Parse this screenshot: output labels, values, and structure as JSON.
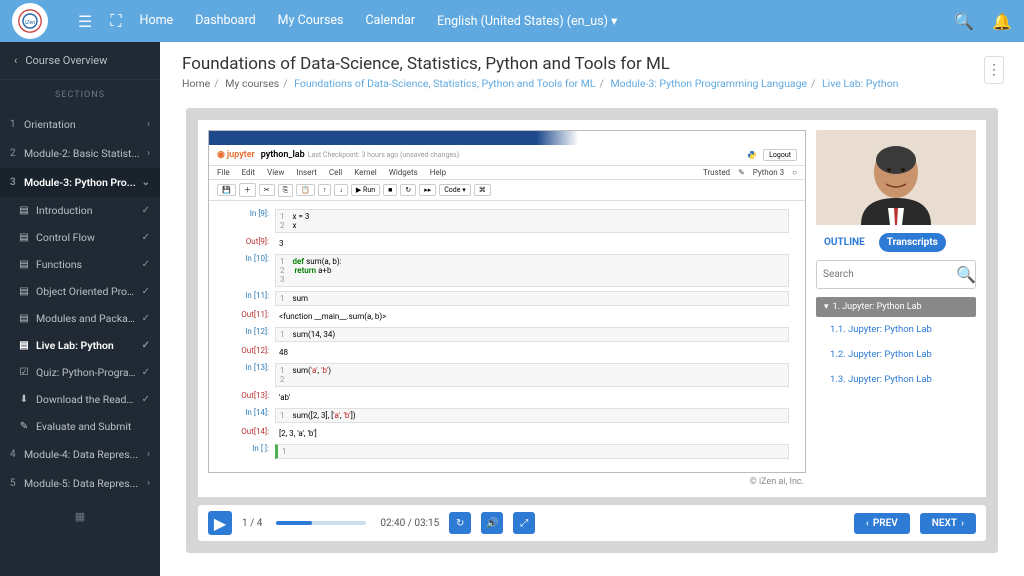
{
  "topbar": {
    "links": [
      "Home",
      "Dashboard",
      "My Courses",
      "Calendar",
      "English (United States) (en_us)"
    ]
  },
  "sidebar": {
    "back": "Course Overview",
    "heading": "SECTIONS",
    "sections": [
      {
        "num": "1",
        "label": "Orientation",
        "expanded": false
      },
      {
        "num": "2",
        "label": "Module-2: Basic Statist...",
        "expanded": false
      },
      {
        "num": "3",
        "label": "Module-3: Python Pro...",
        "expanded": true,
        "active": true
      },
      {
        "num": "4",
        "label": "Module-4: Data Repres...",
        "expanded": false
      },
      {
        "num": "5",
        "label": "Module-5: Data Repres...",
        "expanded": false
      }
    ],
    "subitems": [
      {
        "icon": "doc",
        "label": "Introduction",
        "done": true
      },
      {
        "icon": "doc",
        "label": "Control Flow",
        "done": true
      },
      {
        "icon": "doc",
        "label": "Functions",
        "done": true
      },
      {
        "icon": "doc",
        "label": "Object Oriented Progr...",
        "done": true
      },
      {
        "icon": "doc",
        "label": "Modules and Packages",
        "done": true
      },
      {
        "icon": "doc",
        "label": "Live Lab: Python",
        "done": true,
        "active": true
      },
      {
        "icon": "quiz",
        "label": "Quiz: Python-Program...",
        "done": true
      },
      {
        "icon": "dl",
        "label": "Download the Readme...",
        "done": true
      },
      {
        "icon": "submit",
        "label": "Evaluate and Submit"
      }
    ]
  },
  "page": {
    "title": "Foundations of Data-Science, Statistics, Python and Tools for ML",
    "breadcrumb": [
      "Home",
      "My courses",
      "Foundations of Data-Science, Statistics, Python and Tools for ML",
      "Module-3: Python Programming Language",
      "Live Lab: Python"
    ]
  },
  "jupyter": {
    "logo": "jupyter",
    "title": "python_lab",
    "meta": "Last Checkpoint: 3 hours ago  (unsaved changes)",
    "logout": "Logout",
    "trusted": "Trusted",
    "kernel": "Python 3",
    "menu": [
      "File",
      "Edit",
      "View",
      "Insert",
      "Cell",
      "Kernel",
      "Widgets",
      "Help"
    ],
    "toolbar": {
      "run": "▶ Run",
      "celltype": "Code"
    },
    "cells": [
      {
        "type": "in",
        "n": "9",
        "lines": [
          "x = 3",
          "x"
        ]
      },
      {
        "type": "out",
        "n": "9",
        "text": "3"
      },
      {
        "type": "in",
        "n": "10",
        "lines": [
          "def sum(a, b):",
          "    return a+b",
          ""
        ]
      },
      {
        "type": "in",
        "n": "11",
        "lines": [
          "sum"
        ]
      },
      {
        "type": "out",
        "n": "11",
        "text": "<function __main__.sum(a, b)>"
      },
      {
        "type": "in",
        "n": "12",
        "lines": [
          "sum(14, 34)"
        ]
      },
      {
        "type": "out",
        "n": "12",
        "text": "48"
      },
      {
        "type": "in",
        "n": "13",
        "lines": [
          "sum('a', 'b')",
          ""
        ]
      },
      {
        "type": "out",
        "n": "13",
        "text": "'ab'"
      },
      {
        "type": "in",
        "n": "14",
        "lines": [
          "sum([2, 3], ['a', 'b'])"
        ]
      },
      {
        "type": "out",
        "n": "14",
        "text": "[2, 3, 'a', 'b']"
      },
      {
        "type": "in",
        "n": "",
        "lines": [
          ""
        ],
        "active": true
      }
    ]
  },
  "copyright": "© iZen ai, Inc.",
  "player": {
    "slide": "1 / 4",
    "time": "02:40 / 03:15",
    "prev": "PREV",
    "next": "NEXT"
  },
  "panel": {
    "tabs": {
      "outline": "OUTLINE",
      "trans": "Transcripts"
    },
    "search_placeholder": "Search",
    "ts_head": "1. Jupyter: Python Lab",
    "ts_items": [
      "1.1. Jupyter: Python Lab",
      "1.2. Jupyter: Python Lab",
      "1.3. Jupyter: Python Lab"
    ]
  }
}
